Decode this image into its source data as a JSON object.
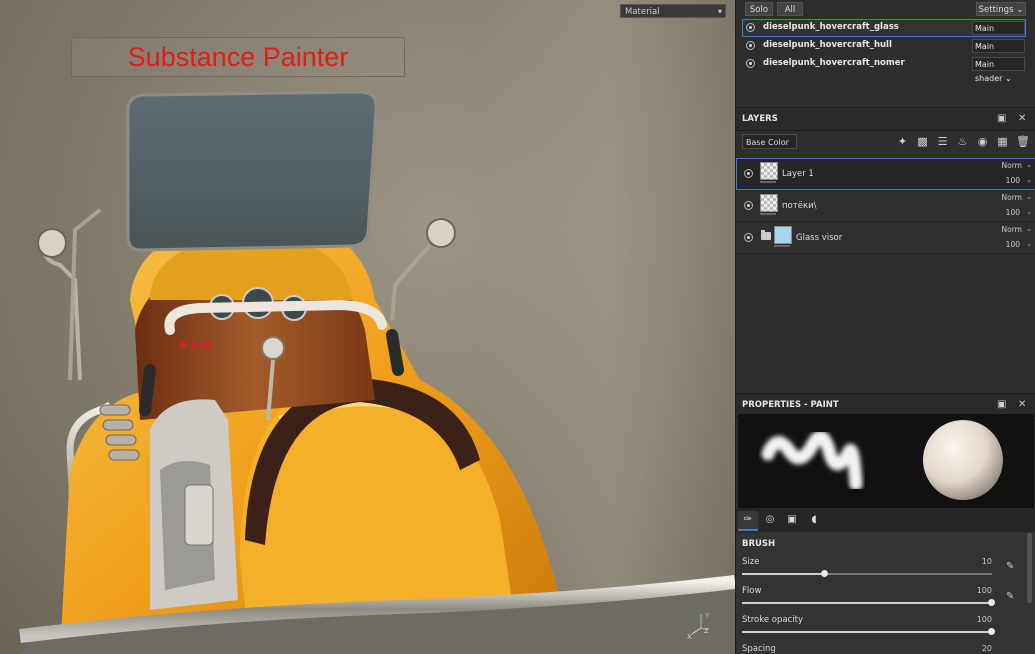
{
  "viewport": {
    "title": "Substance Painter",
    "material_mode": "Material",
    "gizmo_x": "X",
    "gizmo_y": "Y",
    "gizmo_z": "Z"
  },
  "texture_sets": {
    "solo_label": "Solo",
    "all_label": "All",
    "settings_label": "Settings",
    "items": [
      {
        "name": "dieselpunk_hovercraft_glass",
        "shader": "Main shader"
      },
      {
        "name": "dieselpunk_hovercraft_hull",
        "shader": "Main shader"
      },
      {
        "name": "dieselpunk_hovercraft_nomer",
        "shader": "Main shader"
      }
    ]
  },
  "layers": {
    "title": "LAYERS",
    "channel": "Base Color",
    "items": [
      {
        "name": "Layer 1",
        "blend": "Norm",
        "opacity": "100"
      },
      {
        "name": "потёки\\",
        "blend": "Norm",
        "opacity": "100"
      },
      {
        "name": "Glass visor",
        "blend": "Norm",
        "opacity": "100"
      }
    ]
  },
  "properties": {
    "title": "PROPERTIES - PAINT",
    "brush_title": "BRUSH",
    "params": [
      {
        "label": "Size",
        "value": "10",
        "fraction": 0.33
      },
      {
        "label": "Flow",
        "value": "100",
        "fraction": 1.0
      },
      {
        "label": "Stroke opacity",
        "value": "100",
        "fraction": 1.0
      },
      {
        "label": "Spacing",
        "value": "20",
        "fraction": 0.2
      }
    ]
  },
  "colors": {
    "accent": "#3d7fc6",
    "title_red": "#e21c16",
    "body_yellow": "#f2a81d"
  }
}
